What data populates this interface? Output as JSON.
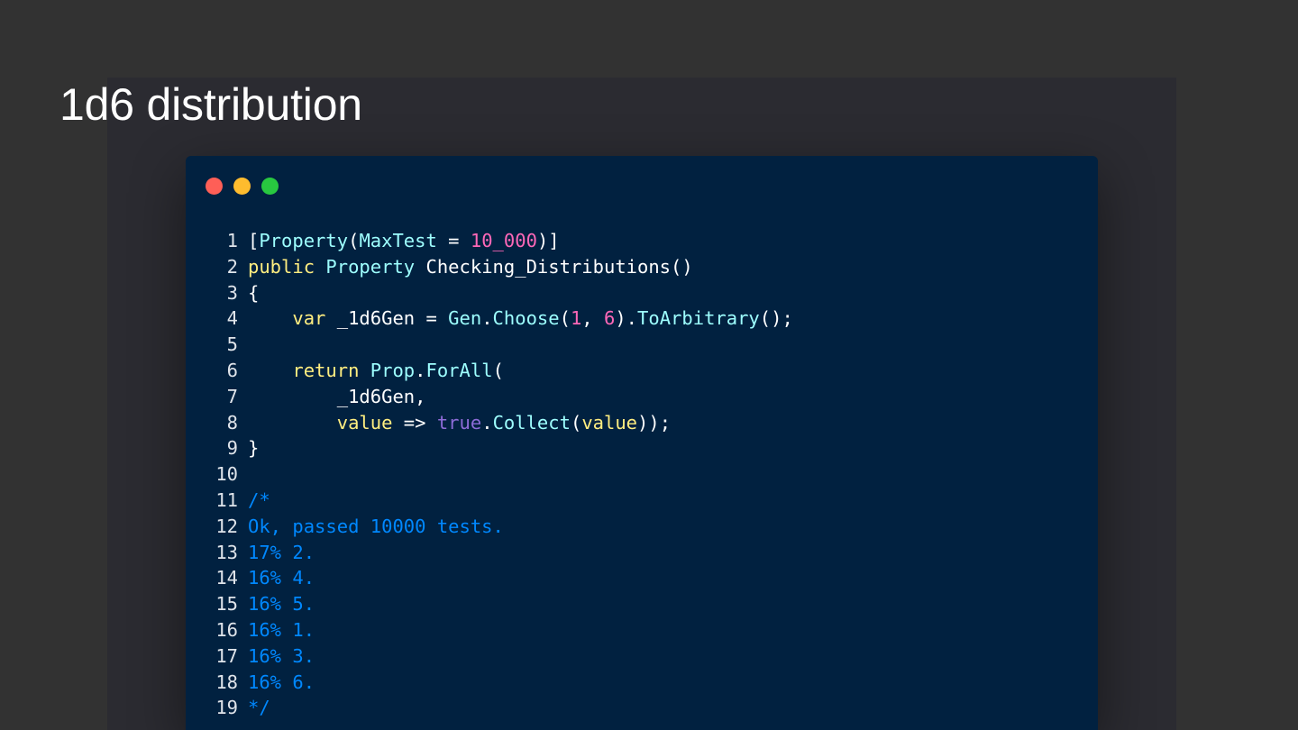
{
  "slide": {
    "title": "1d6 distribution"
  },
  "window": {
    "controls": [
      "close",
      "minimize",
      "maximize"
    ],
    "colors": {
      "background": "#012140",
      "close": "#fe5f57",
      "minimize": "#febc2e",
      "maximize": "#28c840"
    }
  },
  "code": {
    "language": "csharp",
    "lines": [
      {
        "n": "1",
        "tokens": [
          {
            "t": "[",
            "c": "t-white"
          },
          {
            "t": "Property",
            "c": "t-cyan"
          },
          {
            "t": "(",
            "c": "t-white"
          },
          {
            "t": "MaxTest",
            "c": "t-cyan"
          },
          {
            "t": " = ",
            "c": "t-white"
          },
          {
            "t": "10_000",
            "c": "t-magenta"
          },
          {
            "t": ")]",
            "c": "t-white"
          }
        ]
      },
      {
        "n": "2",
        "tokens": [
          {
            "t": "public",
            "c": "t-yellow2"
          },
          {
            "t": " ",
            "c": "t-white"
          },
          {
            "t": "Property",
            "c": "t-cyan"
          },
          {
            "t": " Checking_Distributions()",
            "c": "t-white"
          }
        ]
      },
      {
        "n": "3",
        "tokens": [
          {
            "t": "{",
            "c": "t-white"
          }
        ]
      },
      {
        "n": "4",
        "tokens": [
          {
            "t": "    ",
            "c": "t-white"
          },
          {
            "t": "var",
            "c": "t-yellow2"
          },
          {
            "t": " _1d6Gen = ",
            "c": "t-white"
          },
          {
            "t": "Gen",
            "c": "t-cyan"
          },
          {
            "t": ".",
            "c": "t-white"
          },
          {
            "t": "Choose",
            "c": "t-cyan"
          },
          {
            "t": "(",
            "c": "t-white"
          },
          {
            "t": "1",
            "c": "t-magenta"
          },
          {
            "t": ", ",
            "c": "t-white"
          },
          {
            "t": "6",
            "c": "t-magenta"
          },
          {
            "t": ").",
            "c": "t-white"
          },
          {
            "t": "ToArbitrary",
            "c": "t-cyan"
          },
          {
            "t": "();",
            "c": "t-white"
          }
        ]
      },
      {
        "n": "5",
        "tokens": []
      },
      {
        "n": "6",
        "tokens": [
          {
            "t": "    ",
            "c": "t-white"
          },
          {
            "t": "return",
            "c": "t-yellow2"
          },
          {
            "t": " ",
            "c": "t-white"
          },
          {
            "t": "Prop",
            "c": "t-cyan"
          },
          {
            "t": ".",
            "c": "t-white"
          },
          {
            "t": "ForAll",
            "c": "t-cyan"
          },
          {
            "t": "(",
            "c": "t-white"
          }
        ]
      },
      {
        "n": "7",
        "tokens": [
          {
            "t": "        _1d6Gen,",
            "c": "t-white"
          }
        ]
      },
      {
        "n": "8",
        "tokens": [
          {
            "t": "        ",
            "c": "t-white"
          },
          {
            "t": "value",
            "c": "t-yellow2"
          },
          {
            "t": " => ",
            "c": "t-white"
          },
          {
            "t": "true",
            "c": "t-purple"
          },
          {
            "t": ".",
            "c": "t-white"
          },
          {
            "t": "Collect",
            "c": "t-cyan"
          },
          {
            "t": "(",
            "c": "t-white"
          },
          {
            "t": "value",
            "c": "t-yellow2"
          },
          {
            "t": "));",
            "c": "t-white"
          }
        ]
      },
      {
        "n": "9",
        "tokens": [
          {
            "t": "}",
            "c": "t-white"
          }
        ]
      },
      {
        "n": "10",
        "tokens": []
      },
      {
        "n": "11",
        "tokens": [
          {
            "t": "/*",
            "c": "t-comment"
          }
        ]
      },
      {
        "n": "12",
        "tokens": [
          {
            "t": "Ok, passed 10000 tests.",
            "c": "t-comment"
          }
        ]
      },
      {
        "n": "13",
        "tokens": [
          {
            "t": "17% 2.",
            "c": "t-comment"
          }
        ]
      },
      {
        "n": "14",
        "tokens": [
          {
            "t": "16% 4.",
            "c": "t-comment"
          }
        ]
      },
      {
        "n": "15",
        "tokens": [
          {
            "t": "16% 5.",
            "c": "t-comment"
          }
        ]
      },
      {
        "n": "16",
        "tokens": [
          {
            "t": "16% 1.",
            "c": "t-comment"
          }
        ]
      },
      {
        "n": "17",
        "tokens": [
          {
            "t": "16% 3.",
            "c": "t-comment"
          }
        ]
      },
      {
        "n": "18",
        "tokens": [
          {
            "t": "16% 6.",
            "c": "t-comment"
          }
        ]
      },
      {
        "n": "19",
        "tokens": [
          {
            "t": "*/",
            "c": "t-comment"
          }
        ]
      }
    ]
  }
}
